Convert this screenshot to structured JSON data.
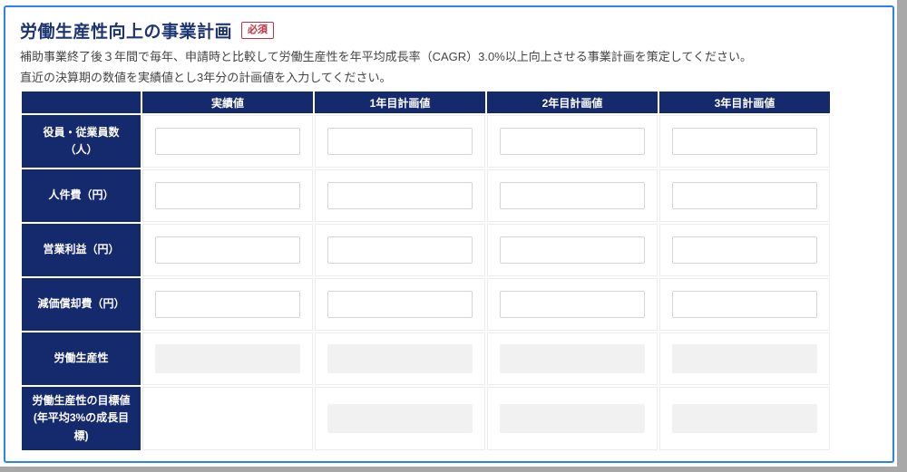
{
  "page": {
    "title": "労働生産性向上の事業計画",
    "required_badge": "必須",
    "description_line1": "補助事業終了後３年間で毎年、申請時と比較して労働生産性を年平均成長率（CAGR）3.0%以上向上させる事業計画を策定してください。",
    "description_line2": "直近の決算期の数値を実績値とし3年分の計画値を入力してください。"
  },
  "table": {
    "column_headers": [
      "実績値",
      "1年目計画値",
      "2年目計画値",
      "3年目計画値"
    ],
    "rows": [
      {
        "key": "employees",
        "label": "役員・従業員数（人）",
        "cells": [
          {
            "col": "actual",
            "type": "input",
            "value": ""
          },
          {
            "col": "year1",
            "type": "input",
            "value": ""
          },
          {
            "col": "year2",
            "type": "input",
            "value": ""
          },
          {
            "col": "year3",
            "type": "input",
            "value": ""
          }
        ]
      },
      {
        "key": "labor_cost",
        "label": "人件費（円）",
        "cells": [
          {
            "col": "actual",
            "type": "input",
            "value": ""
          },
          {
            "col": "year1",
            "type": "input",
            "value": ""
          },
          {
            "col": "year2",
            "type": "input",
            "value": ""
          },
          {
            "col": "year3",
            "type": "input",
            "value": ""
          }
        ]
      },
      {
        "key": "operating_profit",
        "label": "営業利益（円）",
        "cells": [
          {
            "col": "actual",
            "type": "input",
            "value": ""
          },
          {
            "col": "year1",
            "type": "input",
            "value": ""
          },
          {
            "col": "year2",
            "type": "input",
            "value": ""
          },
          {
            "col": "year3",
            "type": "input",
            "value": ""
          }
        ]
      },
      {
        "key": "depreciation",
        "label": "減価償却費（円）",
        "cells": [
          {
            "col": "actual",
            "type": "input",
            "value": ""
          },
          {
            "col": "year1",
            "type": "input",
            "value": ""
          },
          {
            "col": "year2",
            "type": "input",
            "value": ""
          },
          {
            "col": "year3",
            "type": "input",
            "value": ""
          }
        ]
      },
      {
        "key": "productivity",
        "label": "労働生産性",
        "cells": [
          {
            "col": "actual",
            "type": "readonly",
            "value": ""
          },
          {
            "col": "year1",
            "type": "readonly",
            "value": ""
          },
          {
            "col": "year2",
            "type": "readonly",
            "value": ""
          },
          {
            "col": "year3",
            "type": "readonly",
            "value": ""
          }
        ]
      },
      {
        "key": "productivity_target",
        "label": "労働生産性の目標値(年平均3%の成長目標)",
        "cells": [
          {
            "col": "actual",
            "type": "empty",
            "value": ""
          },
          {
            "col": "year1",
            "type": "readonly",
            "value": ""
          },
          {
            "col": "year2",
            "type": "readonly",
            "value": ""
          },
          {
            "col": "year3",
            "type": "readonly",
            "value": ""
          }
        ]
      }
    ]
  },
  "colors": {
    "header_navy": "#15296d",
    "title_navy": "#1d3672",
    "badge_red": "#c0323e",
    "focus_border_blue": "#2c82e8",
    "edge_grey": "#a8a8a8",
    "readonly_bg": "#f1f1f1"
  }
}
